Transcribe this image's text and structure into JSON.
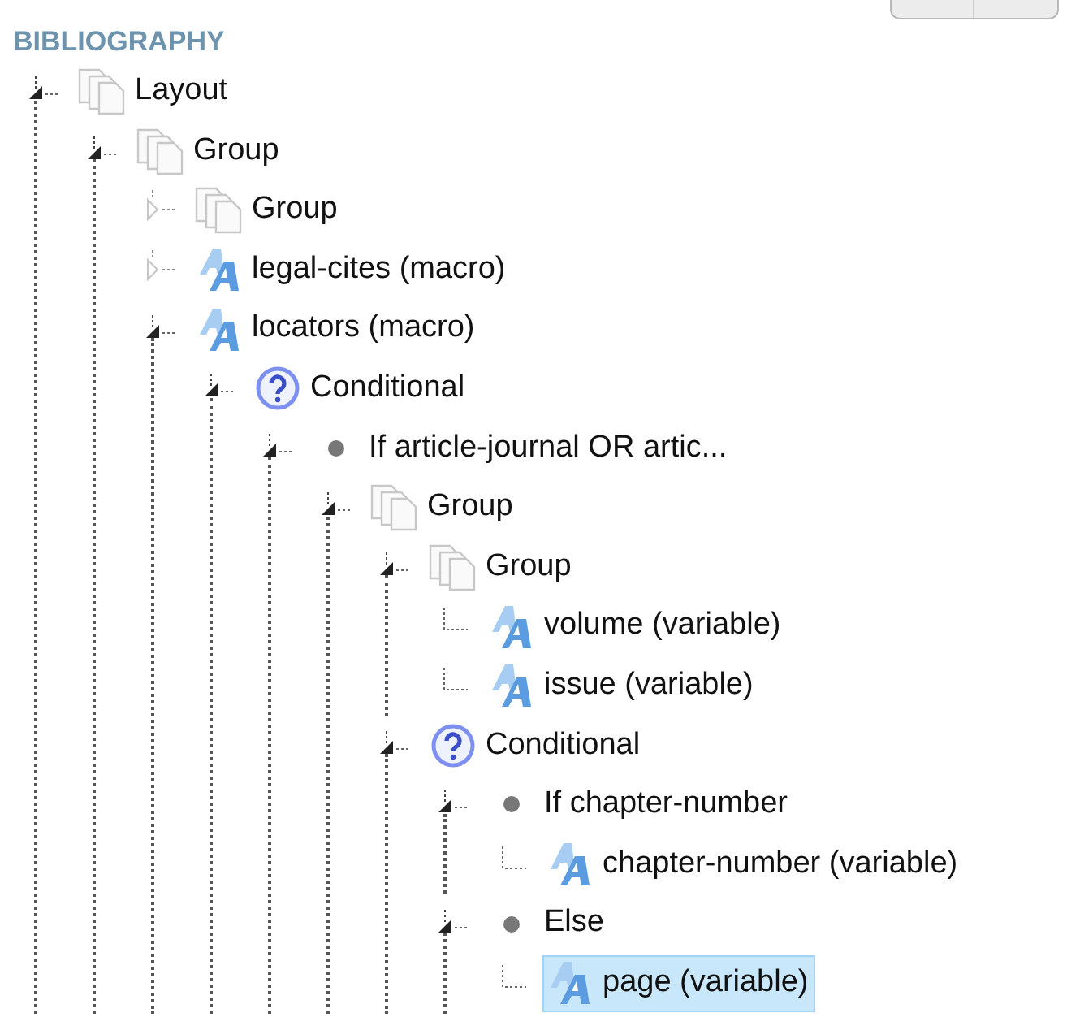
{
  "heading": "BIBLIOGRAPHY",
  "tree": [
    {
      "kind": "group",
      "label": "Layout",
      "expanded": true,
      "selected": false,
      "children": [
        {
          "kind": "group",
          "label": "Group",
          "expanded": true,
          "selected": false,
          "children": [
            {
              "kind": "group",
              "label": "Group",
              "expanded": false,
              "selected": false
            },
            {
              "kind": "macro",
              "label": "legal-cites (macro)",
              "expanded": false,
              "selected": false
            },
            {
              "kind": "macro",
              "label": "locators (macro)",
              "expanded": true,
              "selected": false,
              "children": [
                {
                  "kind": "conditional",
                  "label": "Conditional",
                  "expanded": true,
                  "selected": false,
                  "children": [
                    {
                      "kind": "branch",
                      "label": "If article-journal OR artic...",
                      "expanded": true,
                      "selected": false,
                      "children": [
                        {
                          "kind": "group",
                          "label": "Group",
                          "expanded": true,
                          "selected": false,
                          "children": [
                            {
                              "kind": "group",
                              "label": "Group",
                              "expanded": true,
                              "selected": false,
                              "children": [
                                {
                                  "kind": "variable",
                                  "label": "volume (variable)",
                                  "selected": false
                                },
                                {
                                  "kind": "variable",
                                  "label": "issue (variable)",
                                  "selected": false
                                }
                              ]
                            },
                            {
                              "kind": "conditional",
                              "label": "Conditional",
                              "expanded": true,
                              "selected": false,
                              "children": [
                                {
                                  "kind": "branch",
                                  "label": "If chapter-number",
                                  "expanded": true,
                                  "selected": false,
                                  "children": [
                                    {
                                      "kind": "variable",
                                      "label": "chapter-number (variable)",
                                      "selected": false
                                    }
                                  ]
                                },
                                {
                                  "kind": "branch",
                                  "label": "Else",
                                  "expanded": true,
                                  "selected": false,
                                  "children": [
                                    {
                                      "kind": "variable",
                                      "label": "page (variable)",
                                      "selected": true
                                    }
                                  ]
                                }
                              ]
                            }
                          ]
                        }
                      ]
                    }
                  ]
                }
              ]
            }
          ]
        }
      ]
    }
  ]
}
